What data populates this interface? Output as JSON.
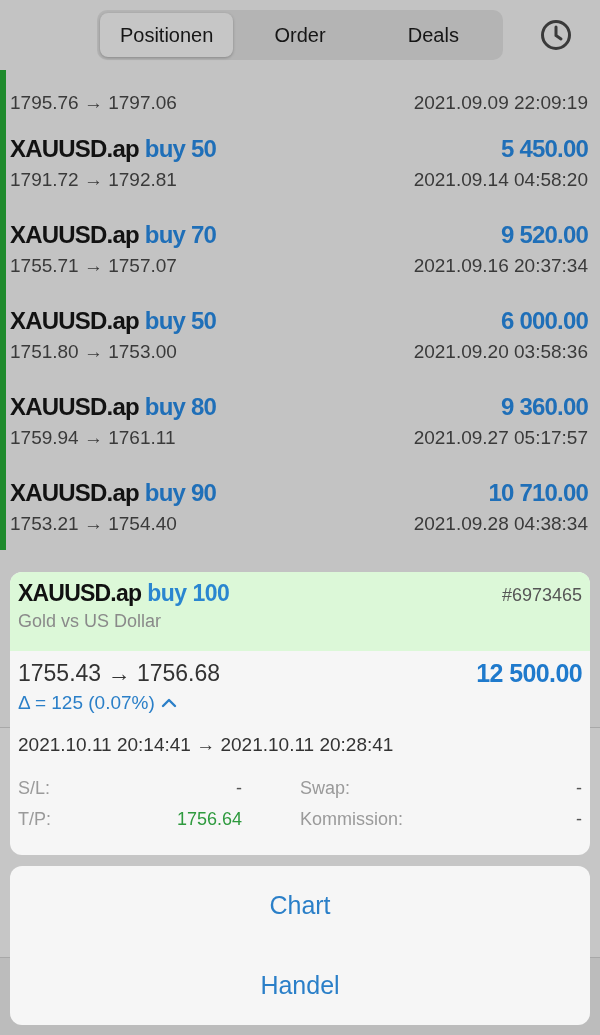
{
  "tabs": [
    {
      "label": "Positionen",
      "selected": true
    },
    {
      "label": "Order",
      "selected": false
    },
    {
      "label": "Deals",
      "selected": false
    }
  ],
  "rows": [
    {
      "prices": "1795.76 → 1797.06",
      "time": "2021.09.09 22:09:19"
    },
    {
      "symbol": "XAUUSD.ap",
      "side": "buy 50",
      "profit": "5 450.00",
      "prices": "1791.72 → 1792.81",
      "time": "2021.09.14 04:58:20"
    },
    {
      "symbol": "XAUUSD.ap",
      "side": "buy 70",
      "profit": "9 520.00",
      "prices": "1755.71 → 1757.07",
      "time": "2021.09.16 20:37:34"
    },
    {
      "symbol": "XAUUSD.ap",
      "side": "buy 50",
      "profit": "6 000.00",
      "prices": "1751.80 → 1753.00",
      "time": "2021.09.20 03:58:36"
    },
    {
      "symbol": "XAUUSD.ap",
      "side": "buy 80",
      "profit": "9 360.00",
      "prices": "1759.94 → 1761.11",
      "time": "2021.09.27 05:17:57"
    },
    {
      "symbol": "XAUUSD.ap",
      "side": "buy 90",
      "profit": "10 710.00",
      "prices": "1753.21 → 1754.40",
      "time": "2021.09.28 04:38:34"
    }
  ],
  "detail": {
    "symbol": "XAUUSD.ap",
    "side": "buy 100",
    "ticket": "#6973465",
    "description": "Gold vs US Dollar",
    "prices": "1755.43 → 1756.68",
    "profit": "12 500.00",
    "delta": "Δ = 125 (0.07%)",
    "times": "2021.10.11 20:14:41 → 2021.10.11 20:28:41",
    "fields": [
      {
        "label": "S/L:",
        "value": "-",
        "kind": "plain"
      },
      {
        "label": "Swap:",
        "value": "-",
        "kind": "plain"
      },
      {
        "label": "T/P:",
        "value": "1756.64",
        "kind": "positive"
      },
      {
        "label": "Kommission:",
        "value": "-",
        "kind": "plain"
      }
    ]
  },
  "actions": [
    "Chart",
    "Handel"
  ]
}
